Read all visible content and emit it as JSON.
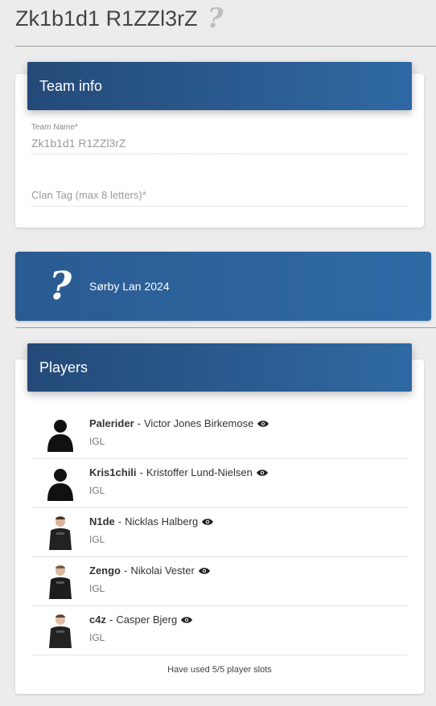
{
  "page": {
    "title": "Zk1b1d1 R1ZZl3rZ",
    "title_icon": "question-mark-icon"
  },
  "team_info": {
    "header": "Team info",
    "team_name_label": "Team Name*",
    "team_name_value": "Zk1b1d1 R1ZZl3rZ",
    "clan_tag_placeholder": "Clan Tag (max 8 letters)*"
  },
  "event": {
    "name": "Sørby Lan 2024",
    "icon": "question-mark-icon"
  },
  "players": {
    "header": "Players",
    "list": [
      {
        "nick": "Palerider",
        "separator": "-",
        "name": "Victor Jones Birkemose",
        "role": "IGL",
        "avatar": "silhouette"
      },
      {
        "nick": "Kris1chili",
        "separator": "-",
        "name": "Kristoffer Lund-Nielsen",
        "role": "IGL",
        "avatar": "silhouette"
      },
      {
        "nick": "N1de",
        "separator": "-",
        "name": "Nicklas Halberg",
        "role": "IGL",
        "avatar": "photo"
      },
      {
        "nick": "Zengo",
        "separator": "-",
        "name": "Nikolai Vester",
        "role": "IGL",
        "avatar": "photo"
      },
      {
        "nick": "c4z",
        "separator": "-",
        "name": "Casper Bjerg",
        "role": "IGL",
        "avatar": "photo"
      }
    ],
    "slots_text": "Have used 5/5 player slots"
  },
  "colors": {
    "header_gradient_start": "#244a78",
    "header_gradient_end": "#2f69a3",
    "background": "#ececec"
  }
}
